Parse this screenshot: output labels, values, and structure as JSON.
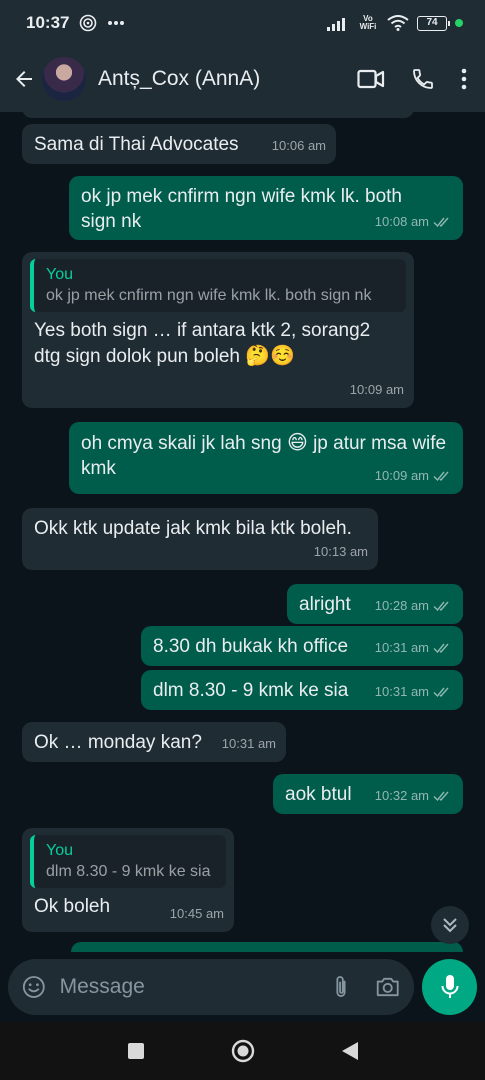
{
  "status_bar": {
    "time": "10:37",
    "network": "Vo WiFi",
    "battery": "74"
  },
  "header": {
    "contact_name": "Antș_Cox (AnnA)"
  },
  "messages": [
    {
      "dir": "in",
      "text": "Sama di Thai Advocates",
      "time": "10:06 am"
    },
    {
      "dir": "out",
      "text": "ok jp mek cnfirm ngn wife kmk lk. both sign nk",
      "time": "10:08 am"
    },
    {
      "dir": "in",
      "quote_author": "You",
      "quote_text": "ok jp mek cnfirm ngn wife kmk lk. both sign nk",
      "text": "Yes both sign … if antara ktk 2, sorang2 dtg sign dolok pun boleh",
      "emoji": "🤔☺️",
      "time": "10:09 am"
    },
    {
      "dir": "out",
      "text": "oh cmya skali jk lah sng",
      "emoji": "😄",
      "text_after": "jp atur msa wife kmk",
      "time": "10:09 am"
    },
    {
      "dir": "in",
      "text": "Okk ktk update jak kmk bila ktk boleh.",
      "time": "10:13 am"
    },
    {
      "dir": "out",
      "text": "alright",
      "time": "10:28 am"
    },
    {
      "dir": "out",
      "text": "8.30 dh bukak kh office",
      "time": "10:31 am"
    },
    {
      "dir": "out",
      "text": "dlm 8.30 - 9 kmk ke sia",
      "time": "10:31 am"
    },
    {
      "dir": "in",
      "text": "Ok … monday kan?",
      "time": "10:31 am"
    },
    {
      "dir": "out",
      "text": "aok btul",
      "time": "10:32 am"
    },
    {
      "dir": "in",
      "quote_author": "You",
      "quote_text": "dlm 8.30 - 9 kmk ke sia",
      "text": "Ok boleh",
      "time": "10:45 am"
    }
  ],
  "composer": {
    "placeholder": "Message"
  },
  "colors": {
    "incoming": "#1f2c34",
    "outgoing": "#005c4b",
    "accent": "#00a884"
  }
}
